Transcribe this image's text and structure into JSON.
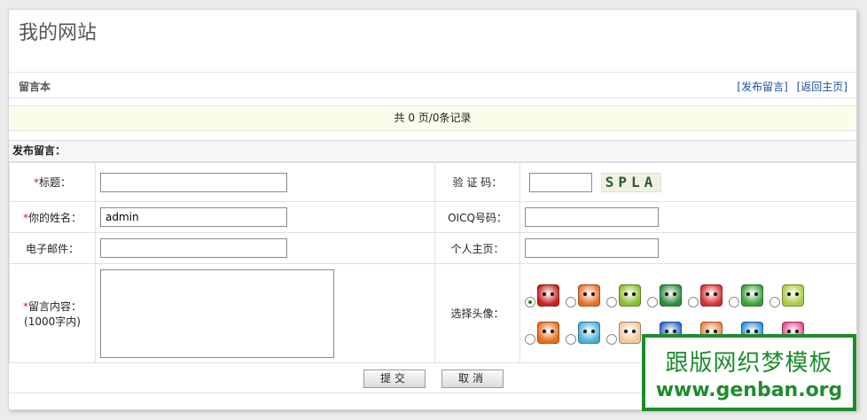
{
  "site": {
    "title": "我的网站"
  },
  "nav": {
    "section": "留言本",
    "links": [
      "[发布留言]",
      "[返回主页]"
    ]
  },
  "pager": {
    "text": "共 0 页/0条记录"
  },
  "form": {
    "heading": "发布留言：",
    "required_mark": "*",
    "fields": {
      "title_label": "标题：",
      "name_label": "你的姓名：",
      "name_value": "admin",
      "email_label": "电子邮件：",
      "content_label": "留言内容：",
      "content_note": "(1000字内)",
      "captcha_label": "验 证 码：",
      "captcha_text": "SPLA",
      "oicq_label": "OICQ号码：",
      "homepage_label": "个人主页：",
      "avatar_label": "选择头像："
    },
    "avatars": {
      "selected_index": 0,
      "colors": [
        "#c8201e",
        "#e8702a",
        "#8cbc2c",
        "#2f8c3e",
        "#d83030",
        "#3ca03a",
        "#a8cc40",
        "#e86c18",
        "#48b0d8",
        "#f0c8a0",
        "#2a6ad0",
        "#f08040",
        "#2a90d8",
        "#e84890"
      ]
    },
    "buttons": {
      "submit": "提交",
      "cancel": "取消"
    }
  },
  "watermark": {
    "line1": "跟版网织梦模板",
    "line2": "www.genban.org"
  }
}
